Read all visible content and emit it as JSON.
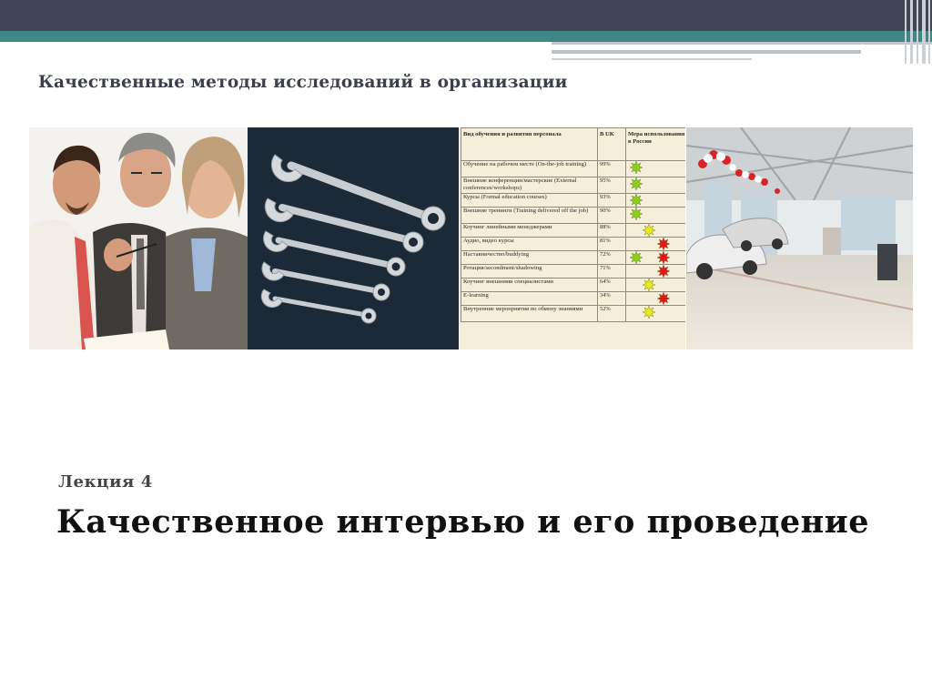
{
  "slide": {
    "subtitle": "Качественные методы исследований в организации",
    "lecture": "Лекция 4",
    "title": "Качественное интервью и его проведение"
  },
  "colors": {
    "top_bar": "#414555",
    "teal_bar": "#3e8785",
    "accent_lines": "#bfc8cf",
    "title_text": "#111111",
    "mark_green": "#8ccf1a",
    "mark_yellow": "#e9e81b",
    "mark_red": "#e01b16"
  },
  "images": [
    {
      "id": "people",
      "icon": "business-people-photo"
    },
    {
      "id": "wrenches",
      "icon": "wrench-set-photo"
    },
    {
      "id": "table",
      "icon": "training-table-image"
    },
    {
      "id": "showroom",
      "icon": "car-showroom-photo"
    }
  ],
  "training_table": {
    "headers": [
      "Вид обучения и развития персонала",
      "В UK",
      "Мера использования в России"
    ],
    "rows": [
      {
        "type": "Обучение на рабочем месте (On-the-job training)",
        "uk": "99%",
        "marks": [
          "green"
        ]
      },
      {
        "type": "Внешние конференции/мастерские (External conferences/workshops)",
        "uk": "95%",
        "marks": [
          "green"
        ]
      },
      {
        "type": "Курсы (Formal education courses)",
        "uk": "93%",
        "marks": [
          "green"
        ]
      },
      {
        "type": "Внешние тренинги (Training delivered off the job)",
        "uk": "90%",
        "marks": [
          "green"
        ]
      },
      {
        "type": "Коучинг линейными менеджерами",
        "uk": "88%",
        "marks": [
          "yellow"
        ]
      },
      {
        "type": "Аудио, видео курсы",
        "uk": "81%",
        "marks": [
          "red"
        ]
      },
      {
        "type": "Наставничество/buddying",
        "uk": "72%",
        "marks": [
          "green",
          "red"
        ]
      },
      {
        "type": "Ротация/secondment/shadowing",
        "uk": "71%",
        "marks": [
          "red"
        ]
      },
      {
        "type": "Коучинг внешними специалистами",
        "uk": "64%",
        "marks": [
          "yellow"
        ]
      },
      {
        "type": "E-learning",
        "uk": "34%",
        "marks": [
          "red"
        ]
      },
      {
        "type": "Внутренние мероприятия по обмену знаниями",
        "uk": "52%",
        "marks": [
          "yellow"
        ]
      }
    ]
  }
}
